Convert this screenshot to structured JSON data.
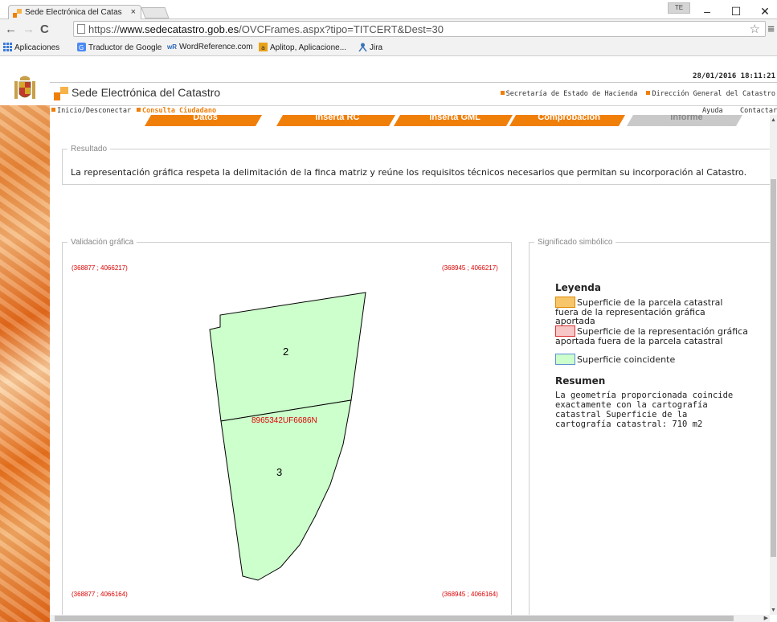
{
  "browser": {
    "tab_title": "Sede Electrónica del Catas",
    "tab_close": "×",
    "user_badge": "TE",
    "win_minimize": "–",
    "win_maximize": "☐",
    "win_close": "✕",
    "url_prefix": "https://",
    "url_host": "www.sedecatastro.gob.es",
    "url_path": "/OVCFrames.aspx?tipo=TITCERT&Dest=30",
    "bookmarks": [
      "Aplicaciones",
      "Traductor de Google",
      "WordReference.com",
      "Aplitop, Aplicacione...",
      "Jira"
    ]
  },
  "header": {
    "datetime": "28/01/2016 18:11:21",
    "site_title": "Sede Electrónica del Catastro",
    "link_secretaria": "Secretaría de Estado de Hacienda",
    "link_direccion": "Dirección General del Catastro"
  },
  "menu": {
    "inicio": "Inicio/Desconectar",
    "consulta": "Consulta Ciudadano",
    "ayuda": "Ayuda",
    "contactar": "Contactar"
  },
  "steps": [
    "Datos",
    "Inserta RC",
    "Inserta GML",
    "Comprobación",
    "Informe"
  ],
  "resultado": {
    "legend": "Resultado",
    "text": "La representación gráfica respeta la delimitación de la finca matriz y reúne los requisitos técnicos necesarios que permitan su incorporación al Catastro."
  },
  "validacion": {
    "legend": "Validación gráfica",
    "coord_top_left": "(368877 ; 4066217)",
    "coord_top_right": "(368945 ; 4066217)",
    "coord_bottom_left": "(368877 ; 4066164)",
    "coord_bottom_right": "(368945 ; 4066164)",
    "parcel_top_label": "2",
    "parcel_bottom_label": "3",
    "cadastral_ref": "8965342UF6686N",
    "fill_color": "#ccffcc"
  },
  "significado": {
    "legend": "Significado simbólico",
    "leyenda_title": "Leyenda",
    "item1": "Superficie de la parcela catastral fuera de la representación gráfica aportada",
    "item2": "Superficie de la representación gráfica aportada fuera de la parcela catastral",
    "item3": "Superficie coincidente",
    "resumen_title": "Resumen",
    "resumen_text": "La geometría proporcionada coincide exactamente con la cartografía catastral Superficie de la cartografía catastral: 710 m2",
    "colors": {
      "orange": "#f7c66b",
      "pink": "#f7c6c6",
      "green": "#ccffcc"
    }
  }
}
